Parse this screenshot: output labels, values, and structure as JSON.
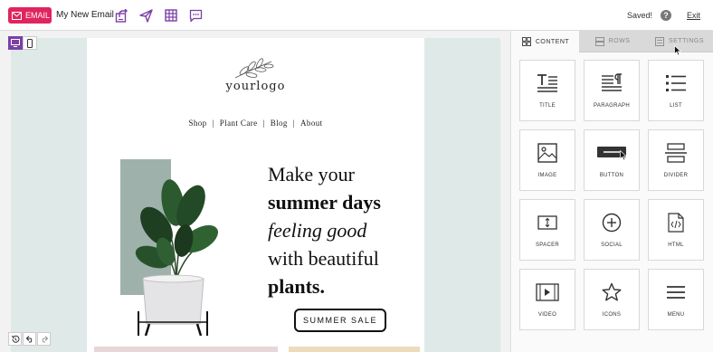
{
  "topbar": {
    "badge": "EMAIL",
    "email_name": "My New Email",
    "status": "Saved!",
    "help": "?",
    "exit": "Exit",
    "tools": [
      "export-icon",
      "send-icon",
      "grid-icon",
      "comment-icon"
    ]
  },
  "email": {
    "logo": "yourlogo",
    "nav": [
      "Shop",
      "Plant Care",
      "Blog",
      "About"
    ],
    "nav_sep": "|",
    "headline": {
      "line1": "Make your",
      "line2": "summer days",
      "line3": "feeling good",
      "line4": "with beautiful",
      "line5": "plants."
    },
    "cta": "SUMMER SALE"
  },
  "panel": {
    "tabs": [
      {
        "label": "CONTENT",
        "icon": "content-icon",
        "active": true
      },
      {
        "label": "ROWS",
        "icon": "rows-icon",
        "active": false
      },
      {
        "label": "SETTINGS",
        "icon": "settings-icon",
        "active": false
      }
    ],
    "tiles": [
      {
        "label": "TITLE",
        "icon": "title-icon"
      },
      {
        "label": "PARAGRAPH",
        "icon": "paragraph-icon"
      },
      {
        "label": "LIST",
        "icon": "list-icon"
      },
      {
        "label": "IMAGE",
        "icon": "image-icon"
      },
      {
        "label": "BUTTON",
        "icon": "button-icon"
      },
      {
        "label": "DIVIDER",
        "icon": "divider-icon"
      },
      {
        "label": "SPACER",
        "icon": "spacer-icon"
      },
      {
        "label": "SOCIAL",
        "icon": "social-icon"
      },
      {
        "label": "HTML",
        "icon": "html-icon"
      },
      {
        "label": "VIDEO",
        "icon": "video-icon"
      },
      {
        "label": "ICONS",
        "icon": "icons-icon"
      },
      {
        "label": "MENU",
        "icon": "menu-icon"
      }
    ]
  },
  "colors": {
    "accent": "#e0245e",
    "purple": "#7b3fa6",
    "email_bg": "#dfe9e7"
  }
}
